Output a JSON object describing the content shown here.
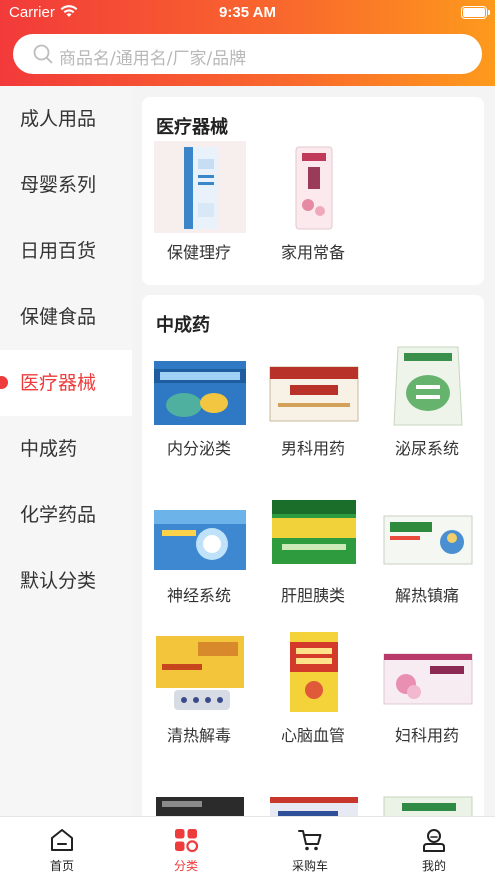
{
  "status_bar": {
    "carrier": "Carrier",
    "time": "9:35 AM"
  },
  "search": {
    "placeholder": "商品名/通用名/厂家/品牌",
    "icon": "search-icon"
  },
  "sidebar": {
    "active_index": 4,
    "items": [
      {
        "label": "成人用品"
      },
      {
        "label": "母婴系列"
      },
      {
        "label": "日用百货"
      },
      {
        "label": "保健食品"
      },
      {
        "label": "医疗器械"
      },
      {
        "label": "中成药"
      },
      {
        "label": "化学药品"
      },
      {
        "label": "默认分类"
      }
    ]
  },
  "sections": [
    {
      "title": "医疗器械",
      "items": [
        {
          "label": "保健理疗",
          "image": "product-box-blue-white"
        },
        {
          "label": "家用常备",
          "image": "product-bottle-pink"
        }
      ]
    },
    {
      "title": "中成药",
      "items": [
        {
          "label": "内分泌类",
          "image": "product-box-blue"
        },
        {
          "label": "男科用药",
          "image": "product-box-red"
        },
        {
          "label": "泌尿系统",
          "image": "product-bag-green"
        },
        {
          "label": "神经系统",
          "image": "product-box-blue"
        },
        {
          "label": "肝胆胰类",
          "image": "product-box-green-yellow"
        },
        {
          "label": "解热镇痛",
          "image": "product-box-white-green"
        },
        {
          "label": "清热解毒",
          "image": "product-box-yellow"
        },
        {
          "label": "心脑血管",
          "image": "product-box-red-yellow"
        },
        {
          "label": "妇科用药",
          "image": "product-box-pink"
        }
      ]
    }
  ],
  "tabbar": {
    "active_index": 1,
    "tabs": [
      {
        "label": "首页",
        "icon": "home-icon"
      },
      {
        "label": "分类",
        "icon": "category-icon"
      },
      {
        "label": "采购车",
        "icon": "cart-icon"
      },
      {
        "label": "我的",
        "icon": "profile-icon"
      }
    ]
  },
  "colors": {
    "accent": "#ee3b3b",
    "header_start": "#f23a3a",
    "header_end": "#fd9a1c"
  }
}
